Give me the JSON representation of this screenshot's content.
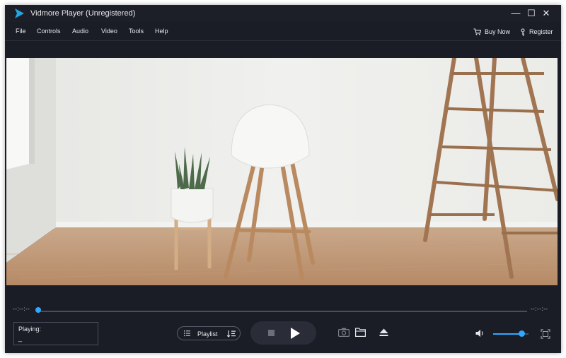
{
  "window": {
    "title": "Vidmore Player (Unregistered)",
    "controls": [
      "—",
      "☐",
      "✕"
    ]
  },
  "menu": {
    "items": [
      "File",
      "Controls",
      "Audio",
      "Video",
      "Tools",
      "Help"
    ],
    "buy_now": "Buy Now",
    "register": "Register"
  },
  "player": {
    "time_elapsed": "--:--:--",
    "time_total": "--:--:--",
    "progress_fraction": 0.0,
    "playing_label": "Playing:",
    "playing_value": "_",
    "playlist_label": "Playlist",
    "volume_fraction": 0.8
  },
  "colors": {
    "accent": "#2fa8ff",
    "background": "#1b1d26",
    "logo": "#1fa8e6"
  },
  "icons": [
    "app-logo-icon",
    "minimize-icon",
    "maximize-icon",
    "close-icon",
    "cart-icon",
    "register-icon",
    "list-icon",
    "playlist-sort-icon",
    "stop-icon",
    "play-icon",
    "snapshot-icon",
    "open-folder-icon",
    "eject-icon",
    "volume-icon",
    "fullscreen-icon"
  ]
}
